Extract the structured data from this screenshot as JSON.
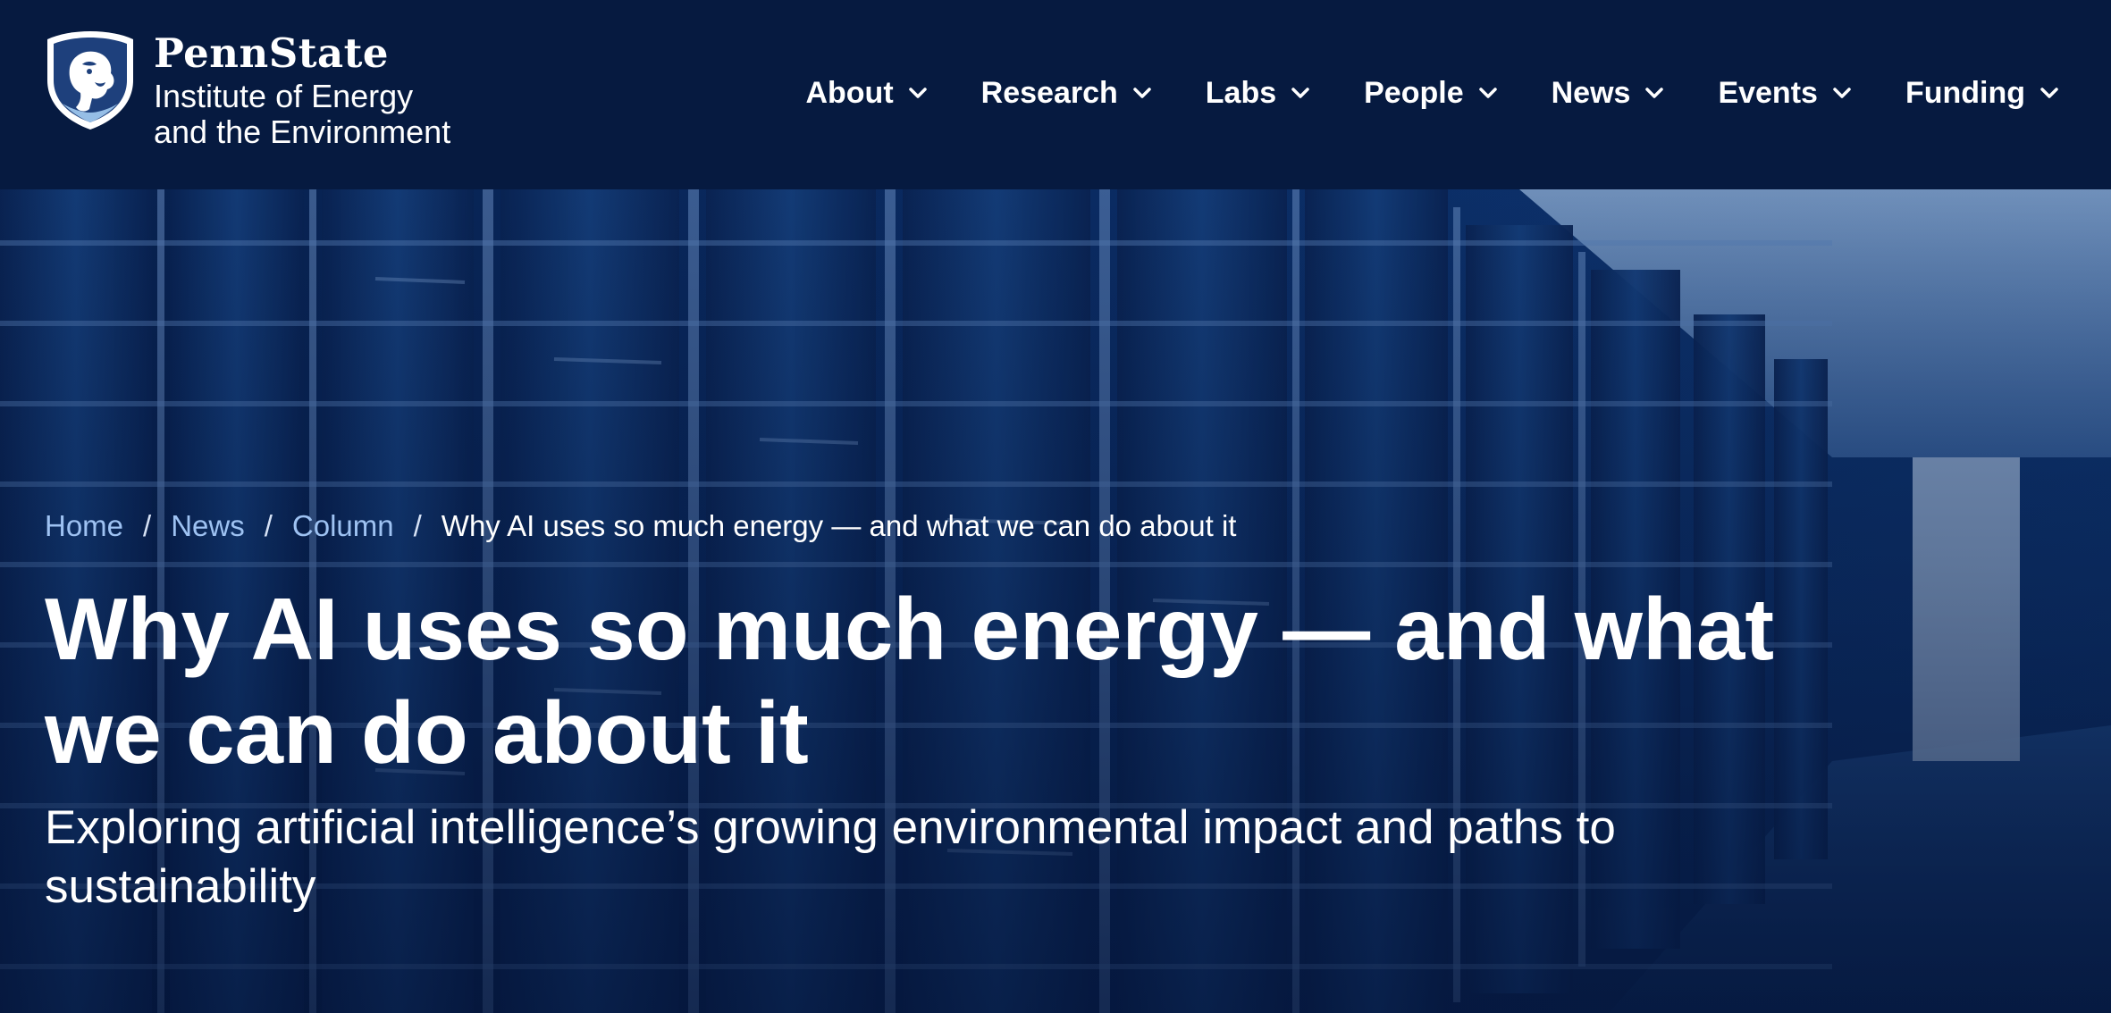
{
  "brand": {
    "name": "PennState",
    "subtitle_line1": "Institute of Energy",
    "subtitle_line2": "and the Environment"
  },
  "nav": {
    "items": [
      {
        "label": "About"
      },
      {
        "label": "Research"
      },
      {
        "label": "Labs"
      },
      {
        "label": "People"
      },
      {
        "label": "News"
      },
      {
        "label": "Events"
      },
      {
        "label": "Funding"
      }
    ]
  },
  "breadcrumb": {
    "home": "Home",
    "news": "News",
    "column": "Column",
    "separator": "/",
    "current": "Why AI uses so much energy — and what we can do about it"
  },
  "article": {
    "title": "Why AI uses so much energy — and what we can do about it",
    "subtitle": "Exploring artificial intelligence’s growing environmental impact and paths to sustainability"
  },
  "colors": {
    "header_bg": "#061a40",
    "breadcrumb_link": "#9ec2f2",
    "text": "#ffffff"
  },
  "icons": {
    "logo": "nittany-lion-shield-icon",
    "nav_chevron": "chevron-down-icon"
  }
}
